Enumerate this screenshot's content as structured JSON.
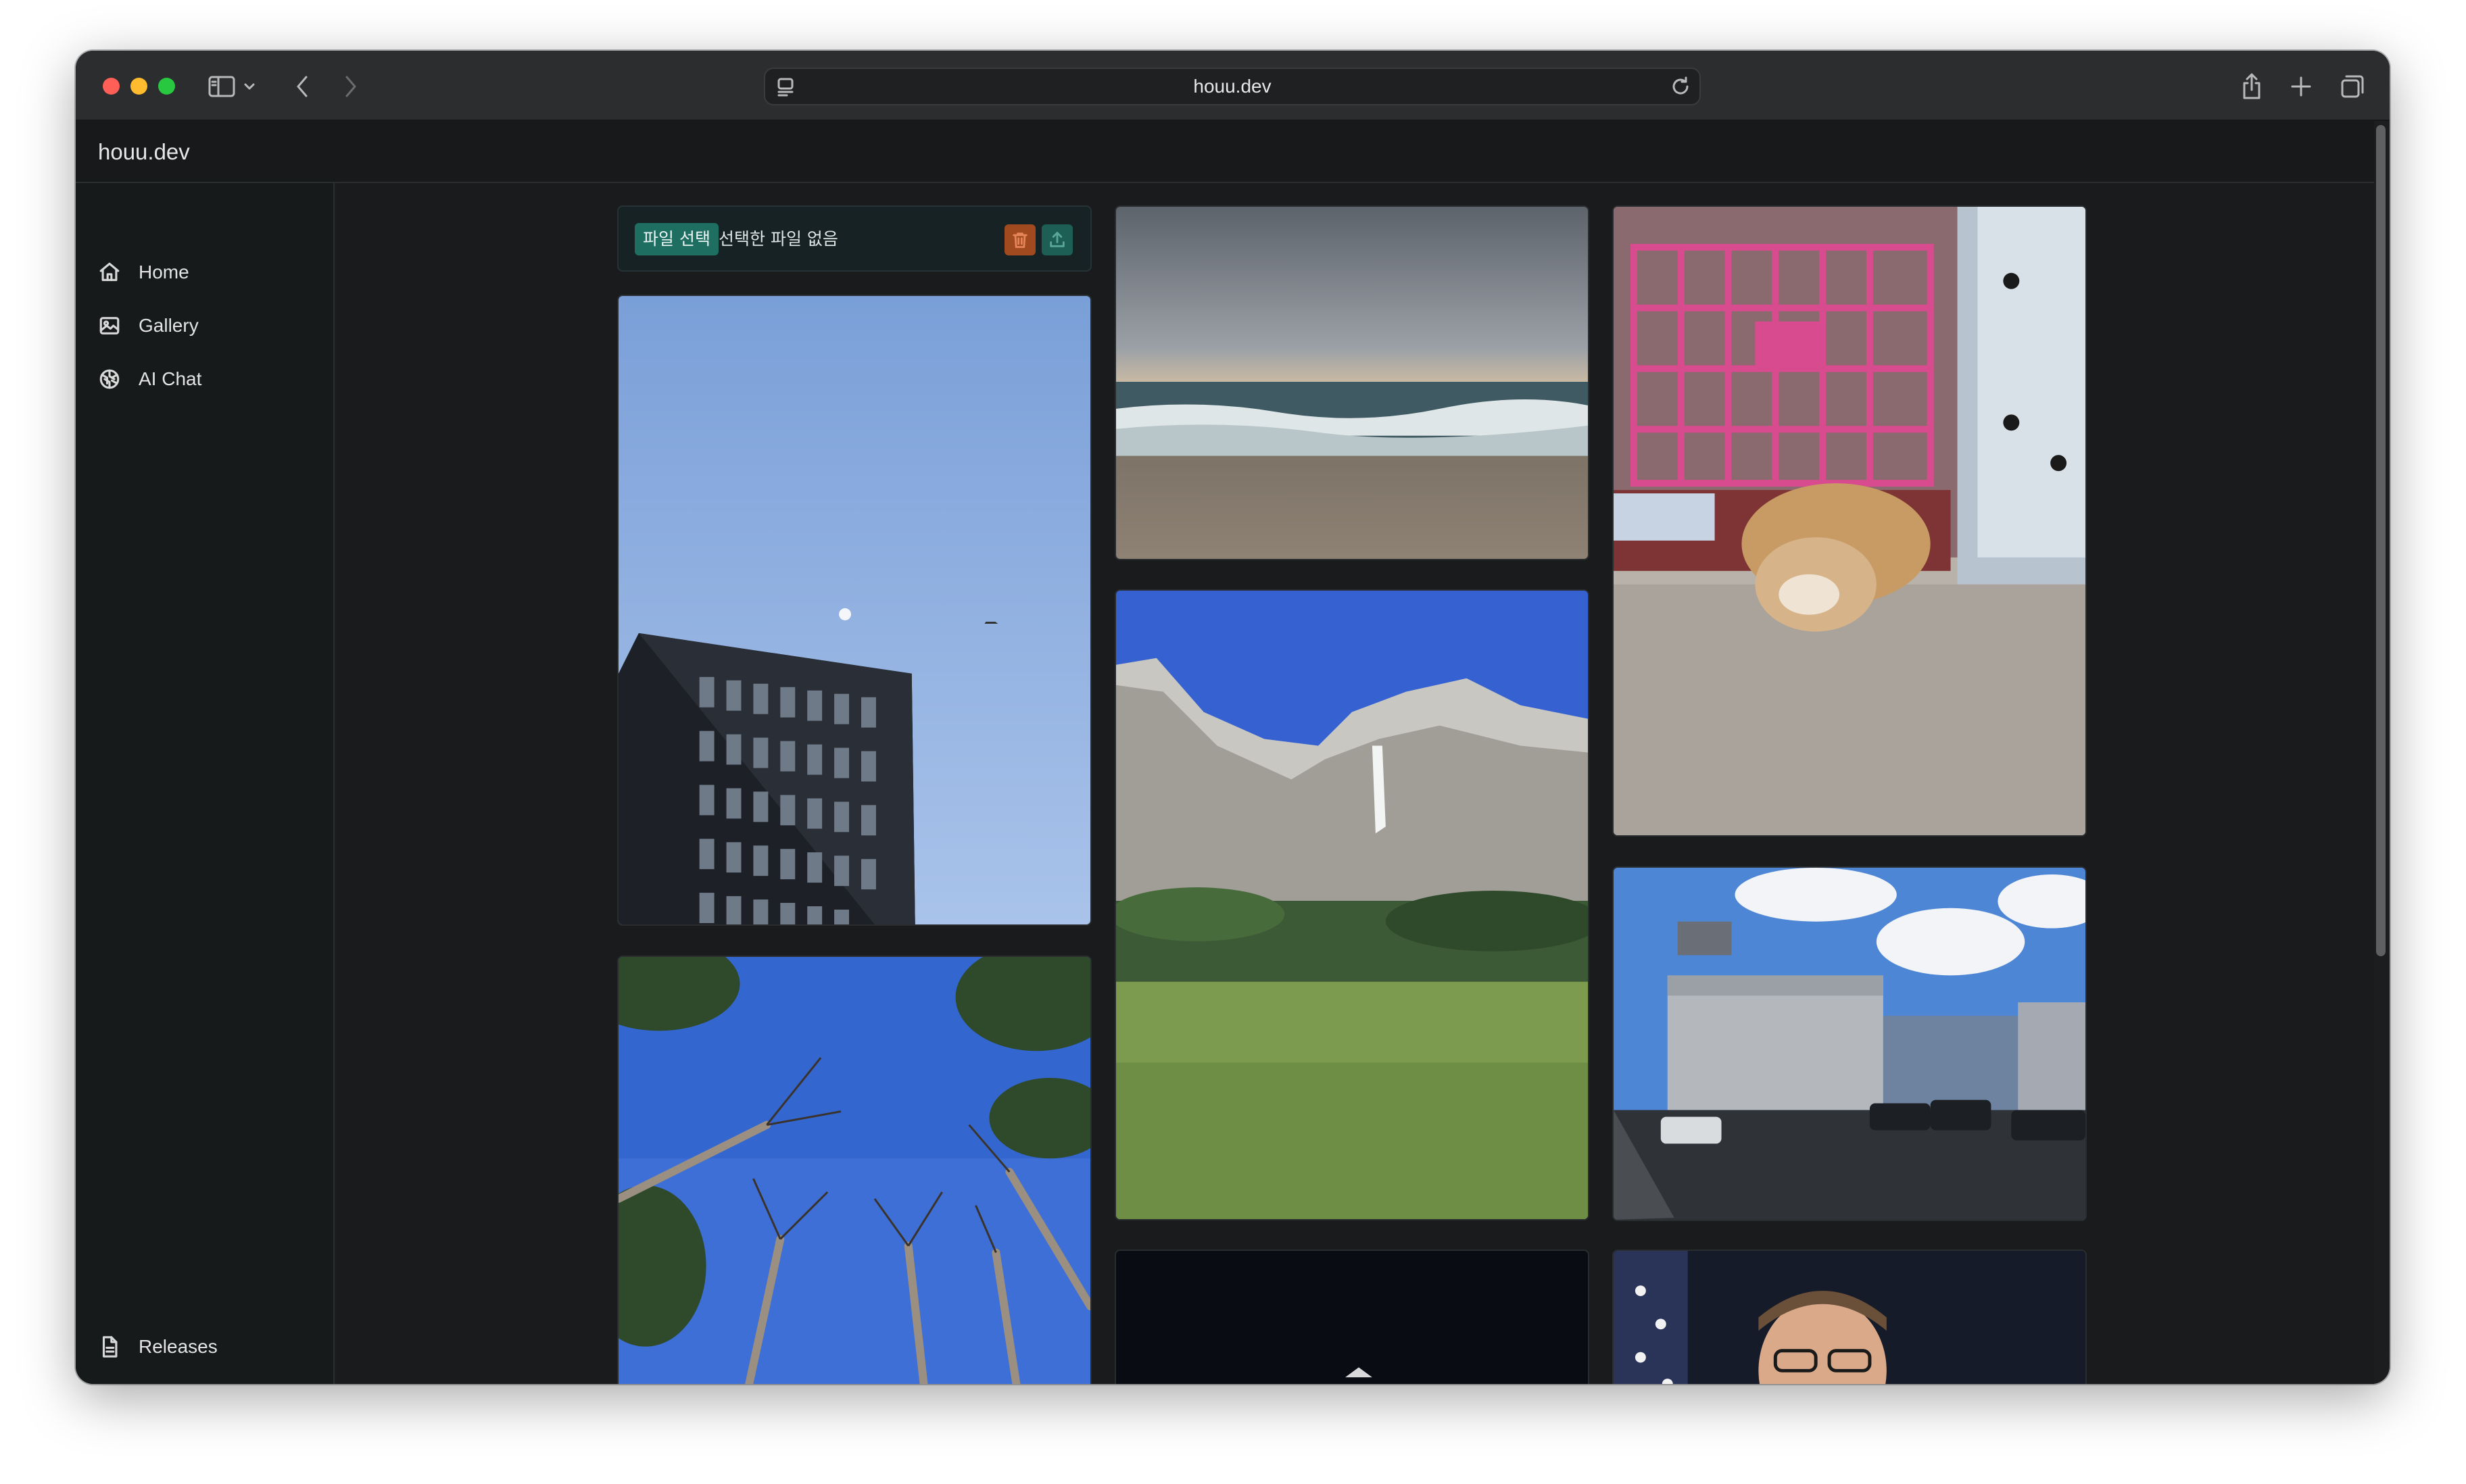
{
  "browser": {
    "url": "houu.dev",
    "icons": [
      "sidebar-toggle-icon",
      "chevron-down-icon",
      "back-icon",
      "forward-icon",
      "page-settings-icon",
      "reload-icon",
      "share-icon",
      "new-tab-icon",
      "tab-overview-icon"
    ]
  },
  "site": {
    "title": "houu.dev"
  },
  "sidebar": {
    "items": [
      {
        "label": "Home",
        "icon": "home-icon"
      },
      {
        "label": "Gallery",
        "icon": "image-icon"
      },
      {
        "label": "AI Chat",
        "icon": "openai-icon"
      }
    ],
    "footer": {
      "label": "Releases",
      "icon": "document-icon"
    }
  },
  "upload": {
    "choose_label": "파일 선택",
    "status": "선택한 파일 없음",
    "delete_color": "#a14a1f",
    "upload_color": "#1d5e55"
  },
  "gallery": {
    "photos": [
      {
        "name": "building-moon-photo"
      },
      {
        "name": "trees-sky-photo"
      },
      {
        "name": "ocean-beach-photo"
      },
      {
        "name": "yosemite-falls-photo"
      },
      {
        "name": "night-photo"
      },
      {
        "name": "bulldog-gate-photo"
      },
      {
        "name": "ipark-mall-photo"
      },
      {
        "name": "portrait-photo"
      }
    ]
  },
  "colors": {
    "accent": "#1f6e62",
    "background": "#1a1b1c",
    "sidebar": "#161a1b"
  }
}
